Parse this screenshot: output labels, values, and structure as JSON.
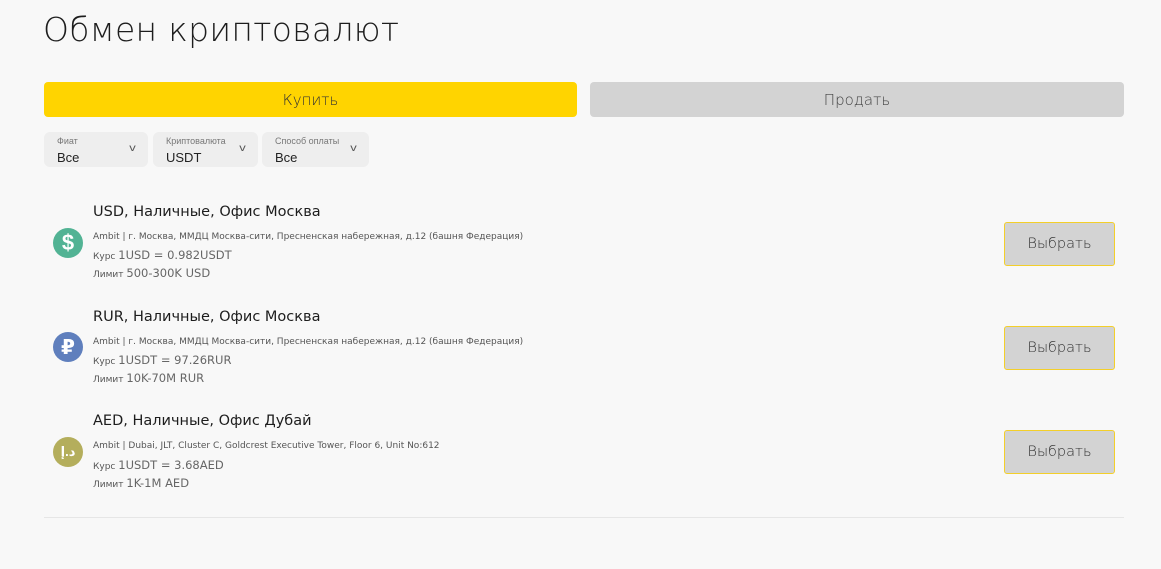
{
  "header": {
    "title": "Обмен криптовалют"
  },
  "tabs": {
    "buy_label": "Купить",
    "sell_label": "Продать",
    "active": "buy"
  },
  "colors": {
    "accent": "#ffd400",
    "inactive_tab": "#d3d3d3",
    "usd_icon": "#52b394",
    "rub_icon": "#5f7fbd",
    "aed_icon": "#b4ae5c"
  },
  "filters": [
    {
      "label": "Фиат",
      "value": "Все"
    },
    {
      "label": "Криптовалюта",
      "value": "USDT"
    },
    {
      "label": "Способ оплаты",
      "value": "Все"
    }
  ],
  "offers": [
    {
      "icon": "dollar-icon",
      "icon_glyph": "$",
      "title": "USD, Наличные, Офис Москва",
      "address": "Ambit | г. Москва, ММДЦ Москва-сити, Пресненская набережная, д.12 (башня Федерация)",
      "rate_label": "Курс",
      "rate_value": "1USD = 0.982USDT",
      "limit_label": "Лимит",
      "limit_value": "500-300K USD",
      "button_label": "Выбрать"
    },
    {
      "icon": "ruble-icon",
      "icon_glyph": "₽",
      "title": "RUR, Наличные, Офис Москва",
      "address": "Ambit | г. Москва, ММДЦ Москва-сити, Пресненская набережная, д.12 (башня Федерация)",
      "rate_label": "Курс",
      "rate_value": "1USDT = 97.26RUR",
      "limit_label": "Лимит",
      "limit_value": "10K-70M RUR",
      "button_label": "Выбрать"
    },
    {
      "icon": "dirham-icon",
      "icon_glyph": "د.إ",
      "title": "AED, Наличные, Офис Дубай",
      "address": "Ambit | Dubai, JLT, Cluster C, Goldcrest Executive Tower, Floor 6, Unit No:612",
      "rate_label": "Курс",
      "rate_value": "1USDT = 3.68AED",
      "limit_label": "Лимит",
      "limit_value": "1K-1M AED",
      "button_label": "Выбрать"
    }
  ]
}
